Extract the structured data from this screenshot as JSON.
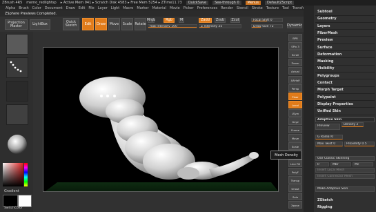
{
  "title_bar": {
    "app": "ZBrush 4R5",
    "doc": "memo_redlightsp",
    "stats": "▸ Active Mem 941 ▸ Scratch Disk 4583 ▸ Free Mem 5254 ▸ ZTime11.73",
    "quicksave": "QuickSave",
    "seethrough": "See-through  0",
    "menus": "Menus",
    "script": "DefaultZScript"
  },
  "menu_bar": [
    "Alpha",
    "Brush",
    "Color",
    "Document",
    "Draw",
    "Edit",
    "File",
    "Layer",
    "Light",
    "Macro",
    "Marker",
    "Material",
    "Movie",
    "Picker",
    "Preferences",
    "Render",
    "Stencil",
    "Stroke",
    "Texture",
    "Tool",
    "Transform",
    "Zplugin",
    "Zscript"
  ],
  "notice": "ZSphere Previews Completed.",
  "toolbar": {
    "projection_master": "Projection Master",
    "lightbox": "LightBox",
    "quick_sketch": "Quick Sketch",
    "edit": "Edit",
    "draw": "Draw",
    "move": "Move",
    "scale": "Scale",
    "rotate": "Rotate",
    "mrgb": "Mrgb",
    "rgb": "Rgb",
    "m": "M",
    "zadd": "Zadd",
    "zsub": "Zsub",
    "zcut": "Zcut",
    "focal_shift": "Focal Shift 0",
    "draw_size": "Draw Size 72",
    "dynamic": "Dynamic",
    "rgb_intensity": "Rgb Intensity 100",
    "z_intensity": "Z Intensity 25"
  },
  "right_shelf": [
    "BPR",
    "SPix 3",
    "Scroll",
    "Zoom",
    "Actual",
    "AAHalf",
    "Persp",
    "Floor",
    "Local",
    "LSym",
    "Gxyz",
    "Frame",
    "Move",
    "Scale",
    "Rotate",
    "Line Fill",
    "PolyF",
    "Transp",
    "Ghost",
    "Solo",
    "Xpose"
  ],
  "panel": {
    "items": [
      "Subtool",
      "Geometry",
      "Layers",
      "FiberMesh",
      "Preview",
      "Surface",
      "Deformation",
      "Masking",
      "Visibility",
      "Polygroups",
      "Contact",
      "Morph Target",
      "Polypaint",
      "Display Properties",
      "Unified Skin"
    ],
    "adaptive_skin": "Adaptive Skin",
    "preview": "Preview",
    "density": "Density 2",
    "g_radial": "G Radial 0",
    "max_twist": "Max Twist 0",
    "proximity": "Proximity 0.5",
    "use_classic": "Use Classic Skinning",
    "ir": "Ir",
    "mbr": "Mbr",
    "mc": "Mc",
    "insert_local_mesh": "Insert Local Mesh",
    "insert_connector": "Insert Connector Mesh",
    "make_adaptive": "Make Adaptive Skin",
    "zsketch": "ZSketch",
    "rigging": "Rigging"
  },
  "left_shelf": {
    "gradient": "Gradient",
    "switch_color": "SwitchColor",
    "alternate": "Alternate"
  },
  "tooltip": "Mesh Density",
  "colors": {
    "accent": "#e07b1a",
    "background": "#2b2b2b",
    "canvas": "#000000",
    "floor": "#0d2a10",
    "model": "#d8d8d8"
  }
}
